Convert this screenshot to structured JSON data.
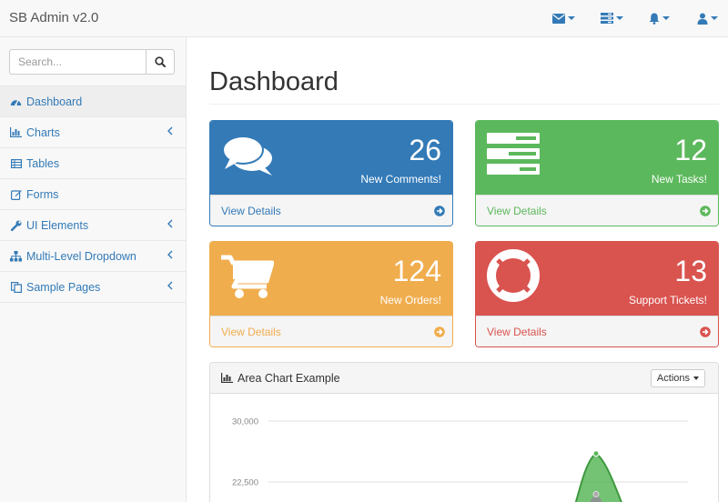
{
  "brand": "SB Admin v2.0",
  "colors": {
    "primary": "#337ab7",
    "green": "#5cb85c",
    "yellow": "#f0ad4e",
    "red": "#d9534f"
  },
  "navbar": {
    "icons": [
      "envelope-icon",
      "tasks-icon",
      "bell-icon",
      "user-icon"
    ]
  },
  "search": {
    "placeholder": "Search..."
  },
  "sidebar": {
    "items": [
      {
        "label": "Dashboard",
        "icon": "dashboard-icon",
        "active": true,
        "has_arrow": false
      },
      {
        "label": "Charts",
        "icon": "bar-chart-icon",
        "has_arrow": true
      },
      {
        "label": "Tables",
        "icon": "table-icon",
        "has_arrow": false
      },
      {
        "label": "Forms",
        "icon": "edit-icon",
        "has_arrow": false
      },
      {
        "label": "UI Elements",
        "icon": "wrench-icon",
        "has_arrow": true
      },
      {
        "label": "Multi-Level Dropdown",
        "icon": "sitemap-icon",
        "has_arrow": true
      },
      {
        "label": "Sample Pages",
        "icon": "files-icon",
        "has_arrow": true
      }
    ]
  },
  "page_title": "Dashboard",
  "cards": [
    {
      "count": "26",
      "label": "New Comments!",
      "footer": "View Details",
      "icon": "comments-icon",
      "color": "#337ab7"
    },
    {
      "count": "12",
      "label": "New Tasks!",
      "footer": "View Details",
      "icon": "tasks-icon",
      "color": "#5cb85c"
    },
    {
      "count": "124",
      "label": "New Orders!",
      "footer": "View Details",
      "icon": "shopping-cart-icon",
      "color": "#f0ad4e"
    },
    {
      "count": "13",
      "label": "Support Tickets!",
      "footer": "View Details",
      "icon": "life-ring-icon",
      "color": "#d9534f"
    }
  ],
  "chart_panel": {
    "title": "Area Chart Example",
    "actions_label": "Actions"
  },
  "chart_data": {
    "type": "area",
    "y_ticks": [
      "30,000",
      "22,500"
    ],
    "y_tick_values": [
      30000,
      22500
    ],
    "grid": true,
    "series": [
      {
        "color": "#5cb85c",
        "peak_value": 26000
      },
      {
        "color": "#8d9093",
        "peak_value": 21000
      }
    ]
  }
}
